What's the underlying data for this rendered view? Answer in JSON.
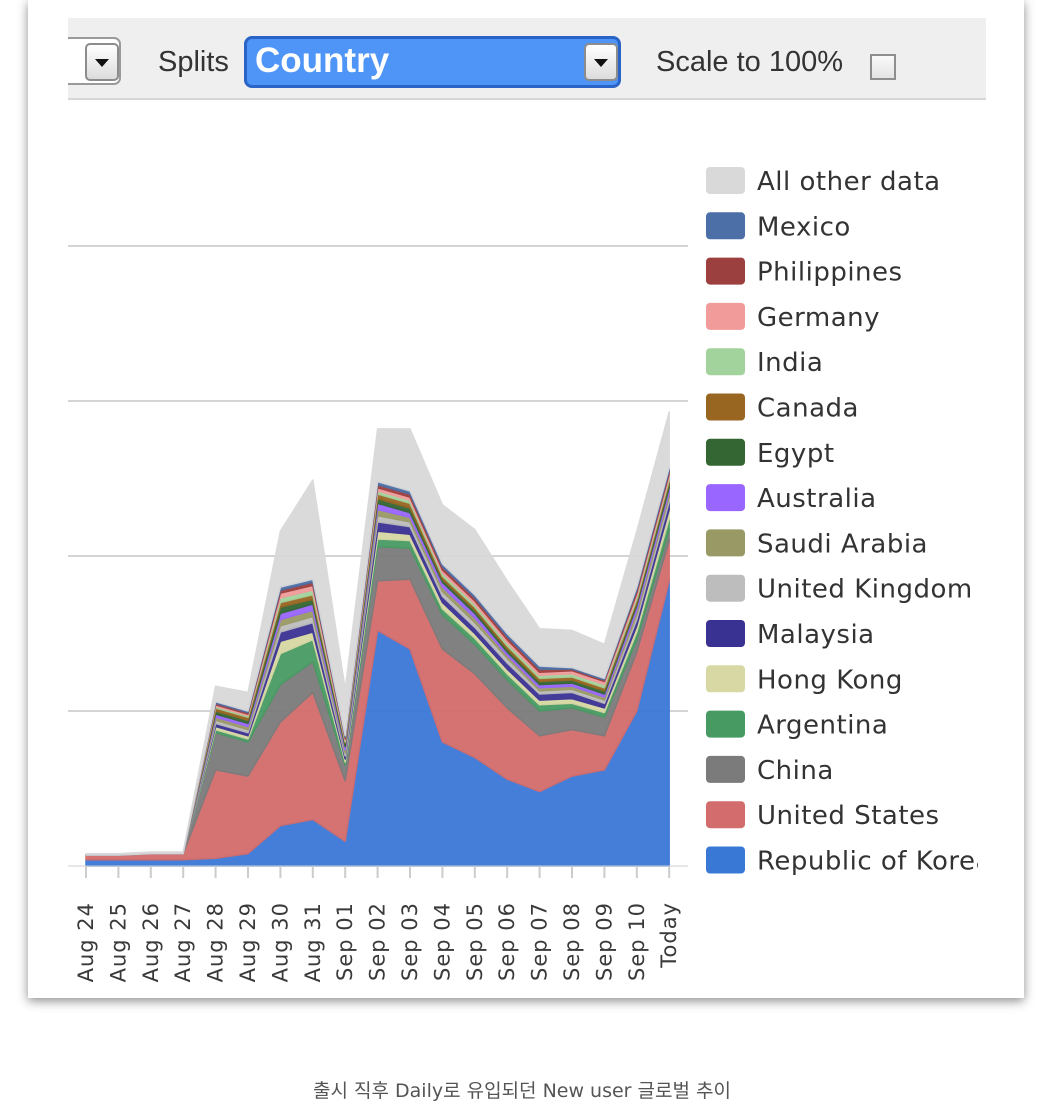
{
  "toolbar": {
    "splits_label": "Splits",
    "splits_value": "Country",
    "scale_label": "Scale to 100%",
    "scale_checked": false,
    "dropdown_arrow_icon": "chevron-down-icon"
  },
  "caption": "출시 직후 Daily로 유입되던 New user 글로벌 추이",
  "chart_data": {
    "type": "area",
    "stacked": true,
    "title": "",
    "xlabel": "",
    "ylabel": "",
    "y_tick_labels_shown": false,
    "grid": true,
    "legend_position": "right",
    "categories": [
      "Aug 24",
      "Aug 25",
      "Aug 26",
      "Aug 27",
      "Aug 28",
      "Aug 29",
      "Aug 30",
      "Aug 31",
      "Sep 01",
      "Sep 02",
      "Sep 03",
      "Sep 04",
      "Sep 05",
      "Sep 06",
      "Sep 07",
      "Sep 08",
      "Sep 09",
      "Sep 10",
      "Today"
    ],
    "ylim": [
      0,
      4
    ],
    "series": [
      {
        "name": "Republic of Korea",
        "color": "#3a78d6",
        "values": [
          0.04,
          0.04,
          0.04,
          0.04,
          0.05,
          0.08,
          0.26,
          0.3,
          0.16,
          1.52,
          1.4,
          0.8,
          0.7,
          0.56,
          0.48,
          0.58,
          0.62,
          1.0,
          1.84
        ]
      },
      {
        "name": "United States",
        "color": "#d36c6c",
        "values": [
          0.03,
          0.03,
          0.04,
          0.04,
          0.57,
          0.5,
          0.67,
          0.82,
          0.39,
          0.32,
          0.45,
          0.6,
          0.54,
          0.46,
          0.36,
          0.3,
          0.22,
          0.38,
          0.26
        ]
      },
      {
        "name": "China",
        "color": "#7b7b7b",
        "values": [
          0,
          0,
          0,
          0,
          0.24,
          0.22,
          0.24,
          0.2,
          0.1,
          0.22,
          0.2,
          0.22,
          0.19,
          0.18,
          0.16,
          0.14,
          0.12,
          0.08,
          0.07
        ]
      },
      {
        "name": "Argentina",
        "color": "#489a63",
        "values": [
          0,
          0,
          0,
          0,
          0.02,
          0.02,
          0.2,
          0.14,
          0.02,
          0.05,
          0.05,
          0.04,
          0.04,
          0.04,
          0.04,
          0.03,
          0.03,
          0.05,
          0.07
        ]
      },
      {
        "name": "Hong Kong",
        "color": "#d8d8a4",
        "values": [
          0,
          0,
          0,
          0,
          0.02,
          0.02,
          0.08,
          0.05,
          0.02,
          0.05,
          0.04,
          0.04,
          0.03,
          0.03,
          0.03,
          0.03,
          0.03,
          0.04,
          0.06
        ]
      },
      {
        "name": "Malaysia",
        "color": "#3a3293",
        "values": [
          0,
          0,
          0,
          0,
          0.02,
          0.02,
          0.06,
          0.06,
          0.02,
          0.06,
          0.05,
          0.04,
          0.04,
          0.04,
          0.04,
          0.04,
          0.03,
          0.04,
          0.05
        ]
      },
      {
        "name": "United Kingdom",
        "color": "#bdbdbd",
        "values": [
          0,
          0,
          0,
          0,
          0.02,
          0.02,
          0.04,
          0.04,
          0.02,
          0.04,
          0.03,
          0.03,
          0.03,
          0.03,
          0.02,
          0.02,
          0.02,
          0.03,
          0.03
        ]
      },
      {
        "name": "Saudi Arabia",
        "color": "#999966",
        "values": [
          0,
          0,
          0,
          0,
          0.02,
          0.02,
          0.04,
          0.04,
          0.02,
          0.04,
          0.03,
          0.03,
          0.03,
          0.02,
          0.02,
          0.02,
          0.02,
          0.03,
          0.03
        ]
      },
      {
        "name": "Australia",
        "color": "#9966ff",
        "values": [
          0,
          0,
          0,
          0,
          0.02,
          0.02,
          0.04,
          0.04,
          0.02,
          0.04,
          0.03,
          0.03,
          0.03,
          0.02,
          0.02,
          0.02,
          0.02,
          0.03,
          0.03
        ]
      },
      {
        "name": "Egypt",
        "color": "#336633",
        "values": [
          0,
          0,
          0,
          0,
          0.02,
          0.02,
          0.04,
          0.03,
          0.02,
          0.03,
          0.03,
          0.02,
          0.02,
          0.02,
          0.02,
          0.02,
          0.02,
          0.02,
          0.03
        ]
      },
      {
        "name": "Canada",
        "color": "#996622",
        "values": [
          0,
          0,
          0,
          0,
          0.02,
          0.02,
          0.03,
          0.03,
          0.01,
          0.03,
          0.03,
          0.02,
          0.02,
          0.02,
          0.02,
          0.02,
          0.02,
          0.02,
          0.02
        ]
      },
      {
        "name": "India",
        "color": "#a3d39c",
        "values": [
          0,
          0,
          0,
          0,
          0.01,
          0.01,
          0.03,
          0.03,
          0.01,
          0.02,
          0.02,
          0.02,
          0.02,
          0.02,
          0.02,
          0.02,
          0.02,
          0.02,
          0.02
        ]
      },
      {
        "name": "Germany",
        "color": "#f19b9b",
        "values": [
          0,
          0,
          0,
          0,
          0.01,
          0.01,
          0.03,
          0.03,
          0.01,
          0.02,
          0.02,
          0.02,
          0.02,
          0.02,
          0.02,
          0.02,
          0.02,
          0.02,
          0.02
        ]
      },
      {
        "name": "Philippines",
        "color": "#9c3f3f",
        "values": [
          0,
          0,
          0,
          0,
          0.01,
          0.01,
          0.02,
          0.02,
          0.01,
          0.02,
          0.02,
          0.02,
          0.02,
          0.02,
          0.02,
          0.01,
          0.01,
          0.02,
          0.02
        ]
      },
      {
        "name": "Mexico",
        "color": "#4c6fa8",
        "values": [
          0,
          0,
          0,
          0,
          0.01,
          0.01,
          0.02,
          0.02,
          0.01,
          0.02,
          0.02,
          0.02,
          0.02,
          0.02,
          0.02,
          0.01,
          0.01,
          0.02,
          0.02
        ]
      },
      {
        "name": "All other data",
        "color": "#d9d9d9",
        "values": [
          0.01,
          0.01,
          0.01,
          0.01,
          0.1,
          0.12,
          0.36,
          0.64,
          0.3,
          0.34,
          0.4,
          0.38,
          0.42,
          0.34,
          0.24,
          0.24,
          0.22,
          0.36,
          0.36
        ]
      }
    ],
    "legend_labels": [
      "All other data",
      "Mexico",
      "Philippines",
      "Germany",
      "India",
      "Canada",
      "Egypt",
      "Australia",
      "Saudi Arabia",
      "United Kingdom",
      "Malaysia",
      "Hong Kong",
      "Argentina",
      "China",
      "United States",
      "Republic of Korea"
    ]
  }
}
